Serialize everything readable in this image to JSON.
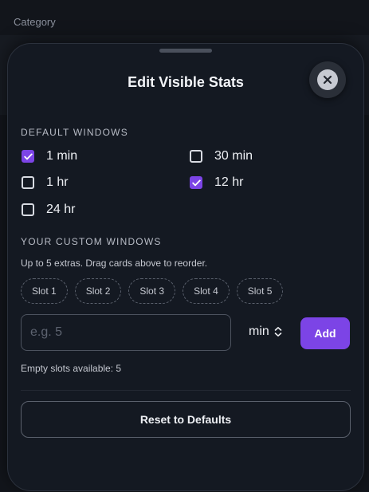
{
  "background": {
    "label": "Category"
  },
  "sheet": {
    "title": "Edit Visible Stats",
    "close_icon": "close-icon",
    "default_windows": {
      "heading": "DEFAULT WINDOWS",
      "options": [
        {
          "label": "1 min",
          "checked": true
        },
        {
          "label": "30 min",
          "checked": false
        },
        {
          "label": "1 hr",
          "checked": false
        },
        {
          "label": "12 hr",
          "checked": true
        },
        {
          "label": "24 hr",
          "checked": false
        }
      ]
    },
    "custom_windows": {
      "heading": "YOUR CUSTOM WINDOWS",
      "hint": "Up to 5 extras. Drag cards above to reorder.",
      "slots": [
        "Slot 1",
        "Slot 2",
        "Slot 3",
        "Slot 4",
        "Slot 5"
      ],
      "input_placeholder": "e.g. 5",
      "input_value": "",
      "unit_selected": "min",
      "add_label": "Add",
      "available_text": "Empty slots available: 5"
    },
    "reset_label": "Reset to Defaults"
  },
  "colors": {
    "accent": "#7c44e6",
    "surface": "#141922",
    "background": "#12151b"
  }
}
